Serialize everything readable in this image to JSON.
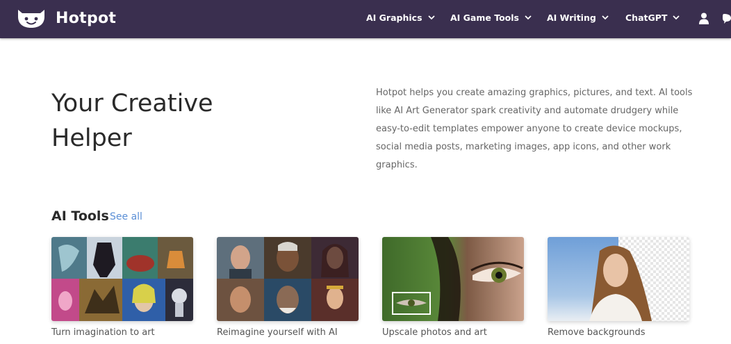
{
  "nav": {
    "brand": "Hotpot",
    "menu": [
      {
        "label": "AI Graphics"
      },
      {
        "label": "AI Game Tools"
      },
      {
        "label": "AI Writing"
      },
      {
        "label": "ChatGPT"
      }
    ],
    "icons": [
      "user-icon",
      "chat-icon",
      "chevron-down-icon",
      "logo-icon"
    ],
    "colors": {
      "background": "#3a2f4f",
      "text": "#ffffff"
    }
  },
  "hero": {
    "title": "Your Creative Helper",
    "description": "Hotpot helps you create amazing graphics, pictures, and text. AI tools like AI Art Generator spark creativity and automate drudgery while easy-to-edit templates empower anyone to create device mockups, social media posts, marketing images, app icons, and other work graphics."
  },
  "tools": {
    "heading": "AI Tools",
    "see_all": "See all",
    "link_color": "#5b8fd6",
    "cards": [
      {
        "label": "Turn imagination to art"
      },
      {
        "label": "Reimagine yourself with AI"
      },
      {
        "label": "Upscale photos and art"
      },
      {
        "label": "Remove backgrounds"
      }
    ]
  }
}
